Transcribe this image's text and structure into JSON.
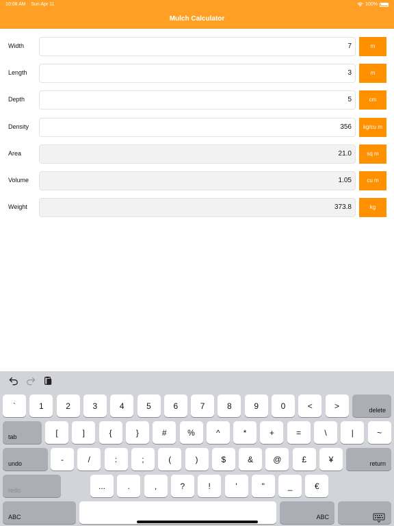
{
  "status_bar": {
    "time": "10:08 AM",
    "date": "Sun Apr 11",
    "battery": "100%"
  },
  "header": {
    "title": "Mulch Calculator"
  },
  "colors": {
    "header": "#FFA024",
    "unit_button": "#FF9000"
  },
  "rows": [
    {
      "label": "Width",
      "value": "7",
      "unit": "m",
      "editable": true
    },
    {
      "label": "Length",
      "value": "3",
      "unit": "m",
      "editable": true
    },
    {
      "label": "Depth",
      "value": "5",
      "unit": "cm",
      "editable": true
    },
    {
      "label": "Density",
      "value": "356",
      "unit": "kg/cu m",
      "editable": true
    },
    {
      "label": "Area",
      "value": "21.0",
      "unit": "sq m",
      "editable": false
    },
    {
      "label": "Volume",
      "value": "1.05",
      "unit": "cu m",
      "editable": false
    },
    {
      "label": "Weight",
      "value": "373.8",
      "unit": "kg",
      "editable": false
    }
  ],
  "keyboard": {
    "toolbar_icons": [
      "undo-icon",
      "redo-icon",
      "paste-icon"
    ],
    "row1": [
      "`",
      "1",
      "2",
      "3",
      "4",
      "5",
      "6",
      "7",
      "8",
      "9",
      "0",
      "<",
      ">"
    ],
    "row1_delete": "delete",
    "row2_tab": "tab",
    "row2": [
      "[",
      "]",
      "{",
      "}",
      "#",
      "%",
      "^",
      "*",
      "+",
      "=",
      "\\",
      "|",
      "~"
    ],
    "row3_undo": "undo",
    "row3": [
      "-",
      "/",
      ":",
      ";",
      "(",
      ")",
      "$",
      "&",
      "@",
      "£",
      "¥"
    ],
    "row3_return": "return",
    "row4_redo": "redo",
    "row4": [
      "...",
      ".",
      ",",
      "?",
      "!",
      "'",
      "\"",
      "_",
      "€"
    ],
    "row5_abc_left": "ABC",
    "row5_abc_right": "ABC",
    "dismiss_icon": "keyboard-dismiss-icon"
  }
}
